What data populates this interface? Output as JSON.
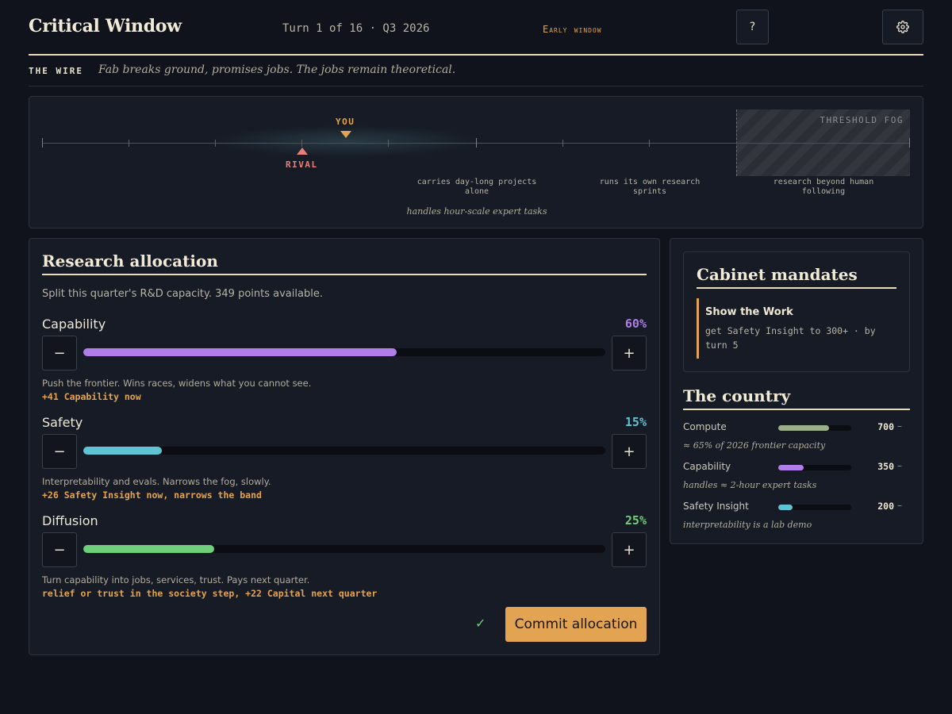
{
  "header": {
    "title": "Critical Window",
    "turn": "Turn 1 of 16 · Q3 2026",
    "phase": "Early window",
    "help_label": "?",
    "settings_icon": "gear-icon"
  },
  "wire": {
    "tag": "THE WIRE",
    "text": "Fab breaks ground, promises jobs. The jobs remain theoretical."
  },
  "track": {
    "you_label": "YOU",
    "rival_label": "RIVAL",
    "fog_label": "THRESHOLD FOG",
    "milestones": [
      "carries day-long projects alone",
      "runs its own research sprints",
      "research beyond human following"
    ],
    "current_note": "handles hour-scale expert tasks"
  },
  "allocation": {
    "title": "Research allocation",
    "subtitle": "Split this quarter's R&D capacity. 349 points available.",
    "sliders": [
      {
        "name": "Capability",
        "percent_label": "60%",
        "fraction": 0.6,
        "color": "#b07ee8",
        "description": "Push the frontier. Wins races, widens what you cannot see.",
        "effect": "+41 Capability now"
      },
      {
        "name": "Safety",
        "percent_label": "15%",
        "fraction": 0.15,
        "color": "#5ec3d3",
        "description": "Interpretability and evals. Narrows the fog, slowly.",
        "effect": "+26 Safety Insight now, narrows the band"
      },
      {
        "name": "Diffusion",
        "percent_label": "25%",
        "fraction": 0.25,
        "color": "#6fcf7a",
        "description": "Turn capability into jobs, services, trust. Pays next quarter.",
        "effect": "relief or trust in the society step, +22 Capital next quarter"
      }
    ],
    "minus_label": "−",
    "plus_label": "+",
    "check_mark": "✓",
    "commit_label": "Commit allocation"
  },
  "mandates": {
    "title": "Cabinet mandates",
    "items": [
      {
        "name": "Show the Work",
        "description": "get Safety Insight to 300+ · by turn 5"
      }
    ]
  },
  "country": {
    "title": "The country",
    "stats": [
      {
        "name": "Compute",
        "value": "700",
        "trend": "–",
        "fraction": 0.7,
        "color": "#9bb08a",
        "note": "≈ 65% of 2026 frontier capacity"
      },
      {
        "name": "Capability",
        "value": "350",
        "trend": "–",
        "fraction": 0.35,
        "color": "#b07ee8",
        "note": "handles ≈ 2-hour expert tasks"
      },
      {
        "name": "Safety Insight",
        "value": "200",
        "trend": "–",
        "fraction": 0.2,
        "color": "#5ec3d3",
        "note": "interpretability is a lab demo"
      }
    ]
  }
}
